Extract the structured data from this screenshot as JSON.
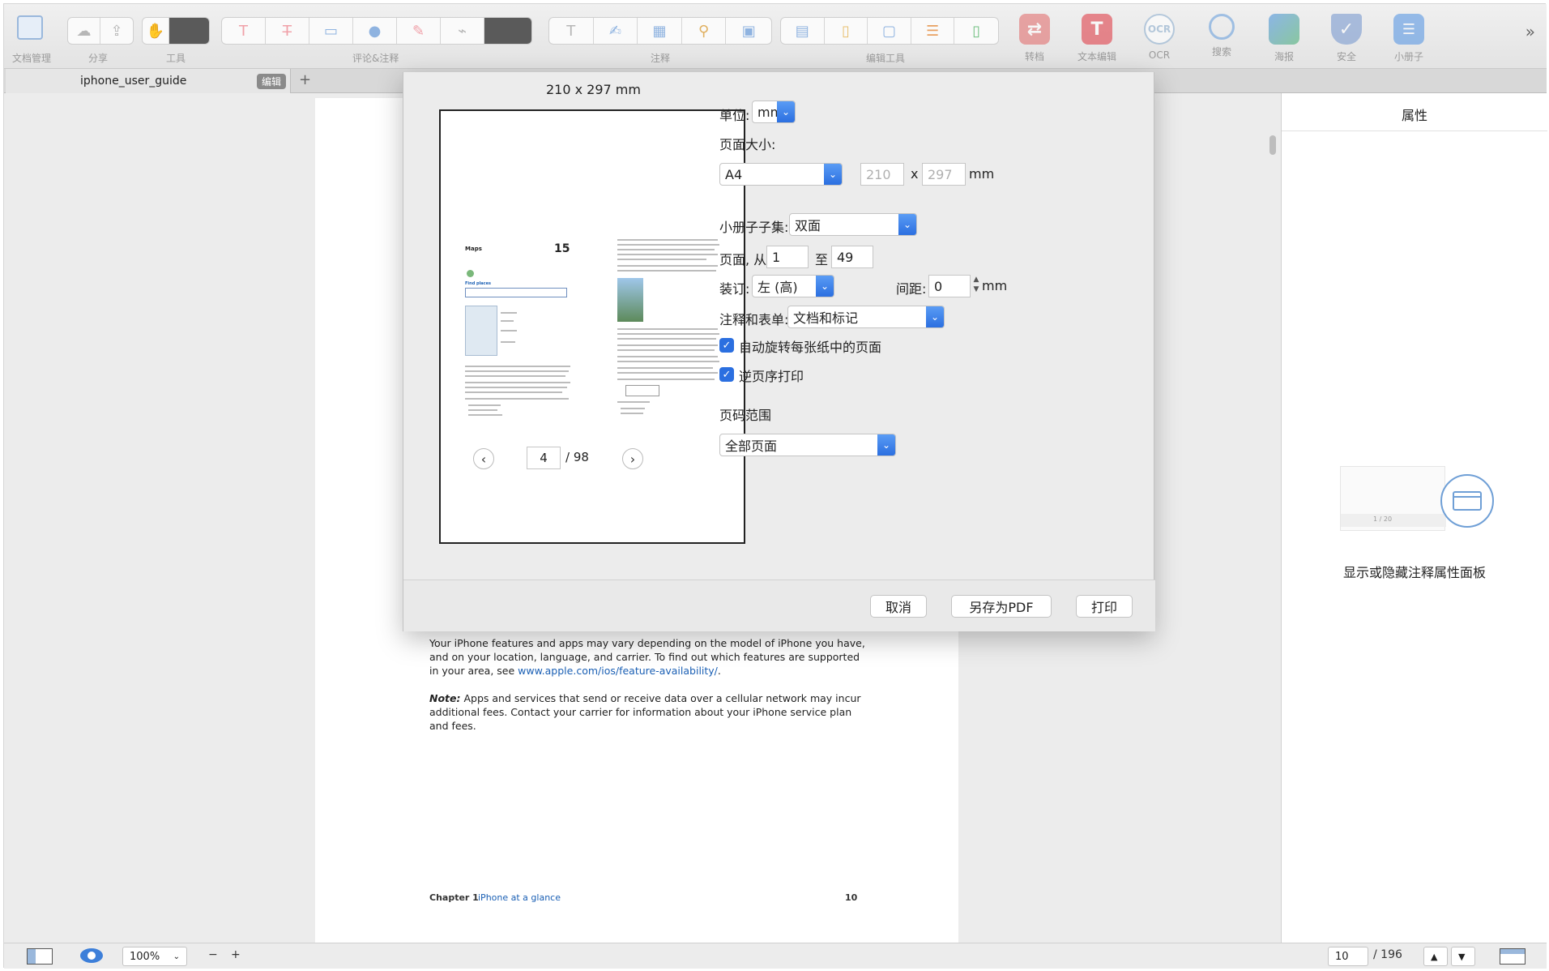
{
  "toolbar": {
    "labels": {
      "doc_manage": "文档管理",
      "share": "分享",
      "tools": "工具",
      "comment_annotate": "评论&注释",
      "annotate": "注释",
      "edit_tools": "编辑工具"
    },
    "big_buttons": [
      {
        "label": "转档",
        "icon": "convert-icon",
        "color": "#e05a5a"
      },
      {
        "label": "文本编辑",
        "icon": "text-edit-icon",
        "color": "#e0404a"
      },
      {
        "label": "OCR",
        "icon": "ocr-icon",
        "color": "#7fa3c8"
      },
      {
        "label": "搜索",
        "icon": "search-icon",
        "color": "#4a8fd8"
      },
      {
        "label": "海报",
        "icon": "poster-icon",
        "color": "#3aa06a"
      },
      {
        "label": "安全",
        "icon": "shield-icon",
        "color": "#5a7fc8"
      },
      {
        "label": "小册子",
        "icon": "booklet-icon",
        "color": "#4a8fe0"
      }
    ],
    "overflow": "»"
  },
  "tab": {
    "title": "iphone_user_guide",
    "edit_badge": "编辑",
    "add": "+"
  },
  "document": {
    "para1": "Your iPhone features and apps may vary depending on the model of iPhone you have, and on your location, language, and carrier. To find out which features are supported in your area, see",
    "link": "www.apple.com/ios/feature-availability/",
    "link_suffix": ".",
    "note_label": "Note:",
    "note_text": " Apps and services that send or receive data over a cellular network may incur additional fees. Contact your carrier for information about your iPhone service plan and fees.",
    "footer_chapter": "Chapter  1",
    "footer_title": "iPhone at a glance",
    "footer_page": "10"
  },
  "right_panel": {
    "title": "属性",
    "caption": "显示或隐藏注释属性面板",
    "mini_page_text": "1 / 20"
  },
  "dialog": {
    "paper_size": "210 x 297 mm",
    "preview": {
      "left_heading": "Maps",
      "left_number": "15",
      "left_subheading": "Find places"
    },
    "nav": {
      "current": "4",
      "total": "/ 98",
      "prev": "‹",
      "next": "›"
    },
    "unit_label": "单位:",
    "unit_value": "mm",
    "page_size_label": "页面大小:",
    "page_size_value": "A4",
    "width": "210",
    "x": "x",
    "height": "297",
    "size_unit": "mm",
    "booklet_label": "小册子子集:",
    "booklet_value": "双面",
    "pages_from_label": "页面, 从",
    "pages_from": "1",
    "pages_to_label": "至",
    "pages_to": "49",
    "binding_label": "装订:",
    "binding_value": "左 (高)",
    "gap_label": "间距:",
    "gap_value": "0",
    "gap_unit": "mm",
    "annotations_label": "注释和表单:",
    "annotations_value": "文档和标记",
    "auto_rotate_label": "自动旋转每张纸中的页面",
    "reverse_label": "逆页序打印",
    "range_label": "页码范围",
    "range_value": "全部页面",
    "cancel": "取消",
    "save_pdf": "另存为PDF",
    "print": "打印"
  },
  "statusbar": {
    "zoom": "100%",
    "minus": "−",
    "plus": "+",
    "page_current": "10",
    "page_total": "/ 196",
    "up": "▲",
    "down": "▼"
  }
}
